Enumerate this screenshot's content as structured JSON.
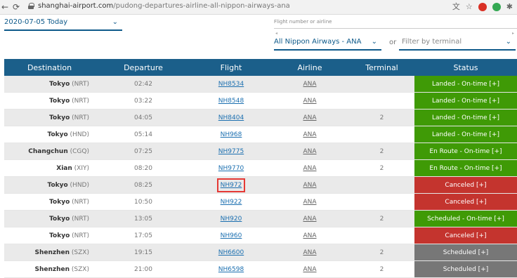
{
  "browser": {
    "domain": "shanghai-airport.com",
    "path": "/pudong-departures-airline-all-nippon-airways-ana",
    "ext_badge": "3"
  },
  "filters": {
    "date": "2020-07-05 Today",
    "flight_placeholder": "Flight number or airline",
    "airline": "All Nippon Airways - ANA",
    "or": "or",
    "terminal_placeholder": "Filter by terminal"
  },
  "table": {
    "headers": [
      "Destination",
      "Departure",
      "Flight",
      "Airline",
      "Terminal",
      "Status"
    ],
    "rows": [
      {
        "city": "Tokyo",
        "code": "(NRT)",
        "time": "02:42",
        "flight": "NH8534",
        "airline": "ANA",
        "terminal": "",
        "status": "Landed - On-time [+]",
        "status_type": "landed"
      },
      {
        "city": "Tokyo",
        "code": "(NRT)",
        "time": "03:22",
        "flight": "NH8548",
        "airline": "ANA",
        "terminal": "",
        "status": "Landed - On-time [+]",
        "status_type": "landed"
      },
      {
        "city": "Tokyo",
        "code": "(NRT)",
        "time": "04:05",
        "flight": "NH8404",
        "airline": "ANA",
        "terminal": "2",
        "status": "Landed - On-time [+]",
        "status_type": "landed"
      },
      {
        "city": "Tokyo",
        "code": "(HND)",
        "time": "05:14",
        "flight": "NH968",
        "airline": "ANA",
        "terminal": "",
        "status": "Landed - On-time [+]",
        "status_type": "landed"
      },
      {
        "city": "Changchun",
        "code": "(CGQ)",
        "time": "07:25",
        "flight": "NH9775",
        "airline": "ANA",
        "terminal": "2",
        "status": "En Route - On-time [+]",
        "status_type": "enroute"
      },
      {
        "city": "Xian",
        "code": "(XIY)",
        "time": "08:20",
        "flight": "NH9770",
        "airline": "ANA",
        "terminal": "2",
        "status": "En Route - On-time [+]",
        "status_type": "enroute"
      },
      {
        "city": "Tokyo",
        "code": "(HND)",
        "time": "08:25",
        "flight": "NH972",
        "airline": "ANA",
        "terminal": "",
        "status": "Canceled [+]",
        "status_type": "canceled",
        "highlight": true
      },
      {
        "city": "Tokyo",
        "code": "(NRT)",
        "time": "10:50",
        "flight": "NH922",
        "airline": "ANA",
        "terminal": "",
        "status": "Canceled [+]",
        "status_type": "canceled"
      },
      {
        "city": "Tokyo",
        "code": "(NRT)",
        "time": "13:05",
        "flight": "NH920",
        "airline": "ANA",
        "terminal": "2",
        "status": "Scheduled - On-time [+]",
        "status_type": "scheduled-ot"
      },
      {
        "city": "Tokyo",
        "code": "(NRT)",
        "time": "17:05",
        "flight": "NH960",
        "airline": "ANA",
        "terminal": "",
        "status": "Canceled [+]",
        "status_type": "canceled"
      },
      {
        "city": "Shenzhen",
        "code": "(SZX)",
        "time": "19:15",
        "flight": "NH6600",
        "airline": "ANA",
        "terminal": "2",
        "status": "Scheduled [+]",
        "status_type": "scheduled"
      },
      {
        "city": "Shenzhen",
        "code": "(SZX)",
        "time": "21:00",
        "flight": "NH6598",
        "airline": "ANA",
        "terminal": "2",
        "status": "Scheduled [+]",
        "status_type": "scheduled"
      }
    ]
  }
}
